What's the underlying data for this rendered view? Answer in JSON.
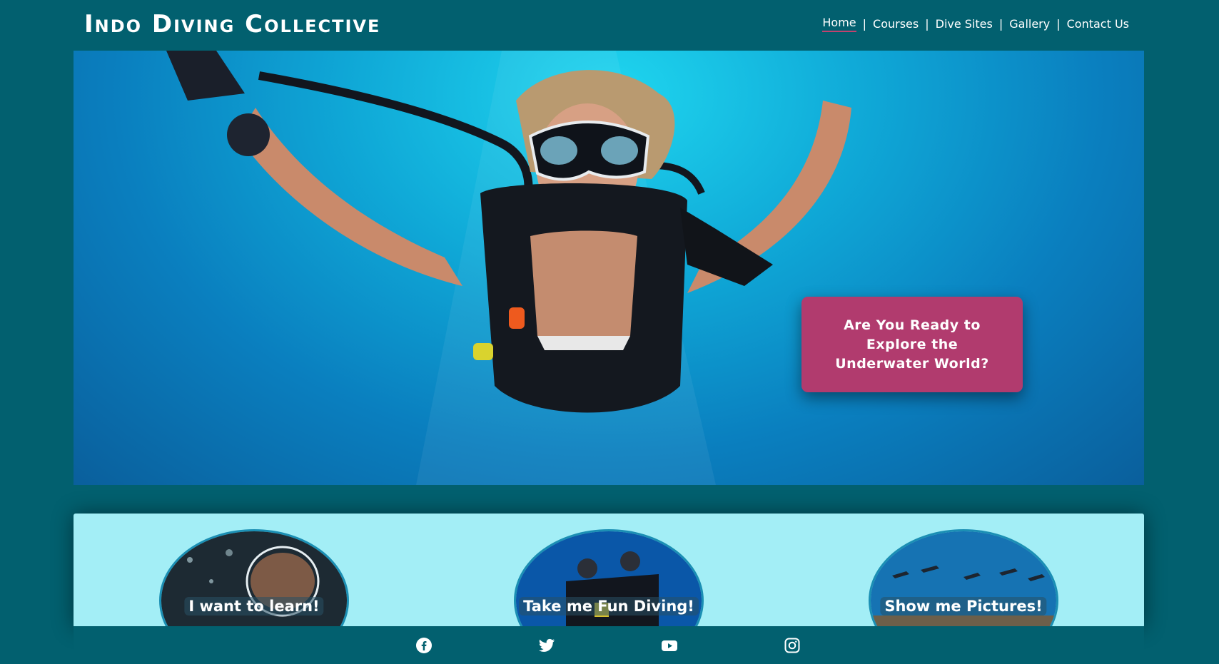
{
  "header": {
    "title": "Indo Diving Collective",
    "nav": [
      {
        "label": "Home",
        "active": true
      },
      {
        "label": "Courses",
        "active": false
      },
      {
        "label": "Dive Sites",
        "active": false
      },
      {
        "label": "Gallery",
        "active": false
      },
      {
        "label": "Contact Us",
        "active": false
      }
    ],
    "separator": "|"
  },
  "hero": {
    "image": "diver-underwater-photo",
    "cta_text": "Are You Ready to Explore the Underwater World?"
  },
  "cards": [
    {
      "label": "I want to learn!",
      "image": "diver-mask-closeup"
    },
    {
      "label": "Take me Fun Diving!",
      "image": "two-divers-photo"
    },
    {
      "label": "Show me Pictures!",
      "image": "group-divers-reef"
    }
  ],
  "footer": {
    "social": [
      "facebook-icon",
      "twitter-icon",
      "youtube-icon",
      "instagram-icon"
    ]
  },
  "colors": {
    "background": "#02606f",
    "cta": "#b13b6e",
    "cards_panel": "#a3eef6",
    "nav_active_underline": "#c2426e"
  }
}
